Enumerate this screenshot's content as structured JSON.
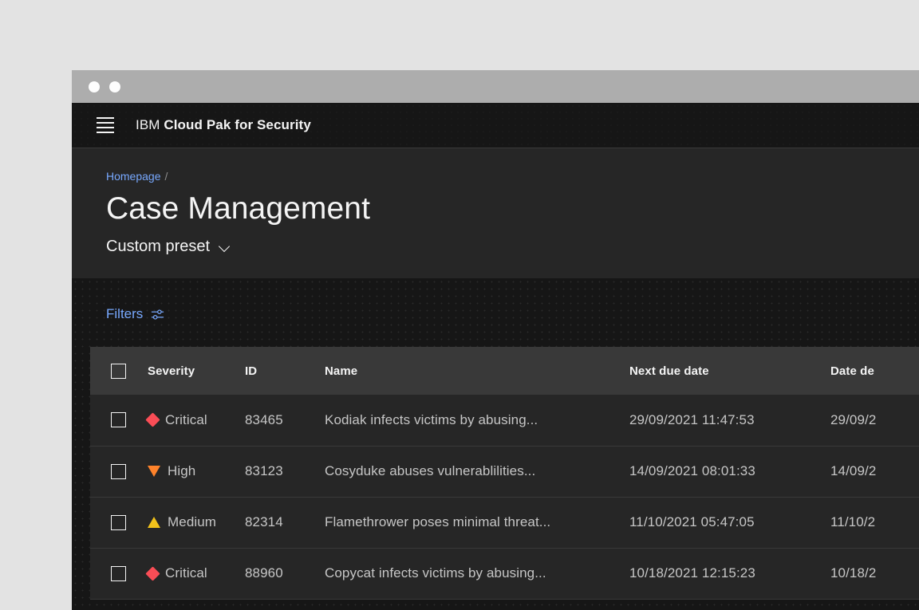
{
  "window": {
    "titlebar_dots": [
      "dot-1",
      "dot-2"
    ]
  },
  "appbar": {
    "menu_icon": "hamburger-menu-icon",
    "brand_prefix": "IBM",
    "brand_product": "Cloud Pak for Security"
  },
  "page_header": {
    "breadcrumb_link": "Homepage",
    "breadcrumb_separator": "/",
    "title": "Case Management",
    "preset_label": "Custom preset",
    "preset_chevron_icon": "chevron-down-icon"
  },
  "toolbar": {
    "filters_label": "Filters",
    "filters_icon": "sliders-settings-icon"
  },
  "table": {
    "columns": [
      {
        "key": "select",
        "label": ""
      },
      {
        "key": "severity",
        "label": "Severity"
      },
      {
        "key": "id",
        "label": "ID"
      },
      {
        "key": "name",
        "label": "Name"
      },
      {
        "key": "next_due_date",
        "label": "Next due date"
      },
      {
        "key": "date_detected",
        "label": "Date de"
      }
    ],
    "select_all_checkbox": "unchecked",
    "rows": [
      {
        "checkbox": "unchecked",
        "severity": "Critical",
        "severity_icon": "diamond-icon",
        "severity_color": "#fa4d56",
        "id": "83465",
        "name": "Kodiak  infects victims by abusing...",
        "next_due_date": "29/09/2021 11:47:53",
        "date_detected": "29/09/2"
      },
      {
        "checkbox": "unchecked",
        "severity": "High",
        "severity_icon": "triangle-down-icon",
        "severity_color": "#ff832b",
        "id": "83123",
        "name": "Cosyduke abuses vulnerablilities...",
        "next_due_date": "14/09/2021 08:01:33",
        "date_detected": "14/09/2"
      },
      {
        "checkbox": "unchecked",
        "severity": "Medium",
        "severity_icon": "triangle-up-icon",
        "severity_color": "#f1c21b",
        "id": "82314",
        "name": " Flamethrower poses minimal threat...",
        "next_due_date": "11/10/2021 05:47:05",
        "date_detected": "11/10/2"
      },
      {
        "checkbox": "unchecked",
        "severity": "Critical",
        "severity_icon": "diamond-icon",
        "severity_color": "#fa4d56",
        "id": "88960",
        "name": "Copycat  infects victims by abusing...",
        "next_due_date": "10/18/2021 12:15:23",
        "date_detected": "10/18/2"
      }
    ]
  },
  "colors": {
    "desktop_bg": "#e3e3e3",
    "titlebar": "#adadad",
    "app_bg": "#161616",
    "header_band": "#262626",
    "table_header": "#393939",
    "row_bg": "#262626",
    "accent_link": "#78a9ff",
    "text_primary": "#f4f4f4",
    "text_secondary": "#c6c6c6",
    "critical": "#fa4d56",
    "high": "#ff832b",
    "medium": "#f1c21b"
  }
}
